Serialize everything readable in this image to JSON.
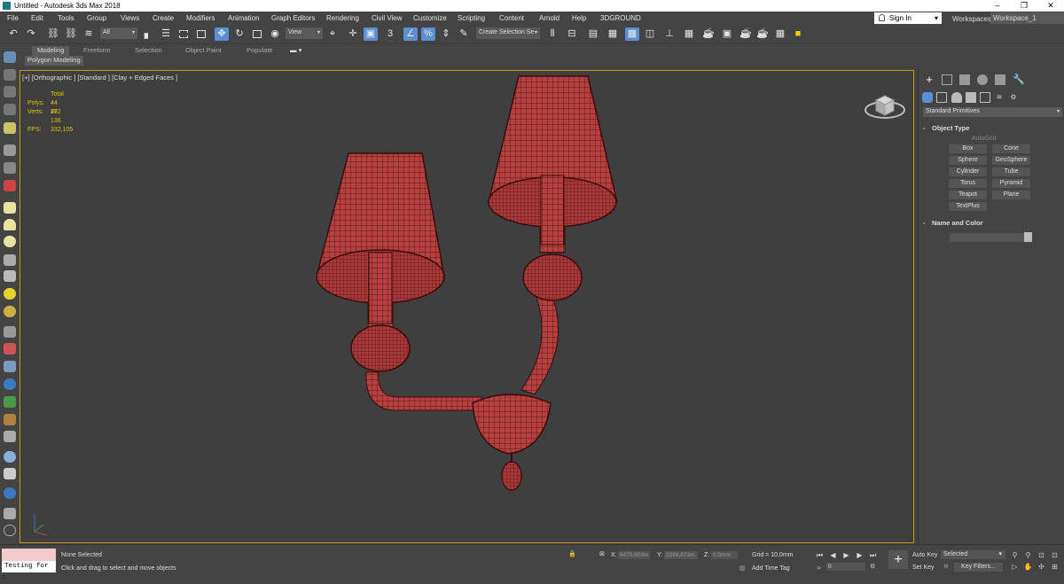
{
  "window": {
    "title": "Untitled - Autodesk 3ds Max 2018",
    "minimize": "–",
    "restore": "❐",
    "close": "✕"
  },
  "menu": [
    "File",
    "Edit",
    "Tools",
    "Group",
    "Views",
    "Create",
    "Modifiers",
    "Animation",
    "Graph Editors",
    "Rendering",
    "Civil View",
    "Customize",
    "Scripting",
    "Content",
    "Arnold",
    "Help",
    "3DGROUND"
  ],
  "signin": {
    "label": "Sign In",
    "caret": "▾"
  },
  "workspaces": {
    "label": "Workspaces:",
    "value": "Workspace_1"
  },
  "toolbar": {
    "filter": "All",
    "ref_coord": "View",
    "snap_label": "3",
    "selection_set": "Create Selection Se",
    "caret": "▾"
  },
  "ribbon": {
    "tabs": [
      "Modeling",
      "Freeform",
      "Selection",
      "Object Paint",
      "Populate"
    ],
    "active_tab": "Modeling",
    "sub": "Polygon Modeling"
  },
  "viewport": {
    "label": "[+] [Orthographic ] [Standard ] [Clay + Edged Faces ]",
    "stats_header": "Total",
    "polys_label": "Polys:",
    "polys": "44 462",
    "verts_label": "Verts:",
    "verts": "27 136",
    "fps_label": "FPS:",
    "fps": "332,105"
  },
  "command_panel": {
    "dropdown": "Standard Primitives",
    "object_type": "Object Type",
    "autogrid": "AutoGrid",
    "primitives": [
      "Box",
      "Cone",
      "Sphere",
      "GeoSphere",
      "Cylinder",
      "Tube",
      "Torus",
      "Pyramid",
      "Teapot",
      "Plane",
      "TextPlus"
    ],
    "name_and_color": "Name and Color",
    "rollout_sign": "-"
  },
  "statusbar": {
    "selection": "None Selected",
    "prompt": "Click and drag to select and move objects",
    "maxscript": "Testing for :",
    "x_label": "X:",
    "x_value": "6475,609m",
    "y_label": "Y:",
    "y_value": "2289,873m",
    "z_label": "Z:",
    "z_value": "0,0mm",
    "grid": "Grid = 10,0mm",
    "add_time_tag": "Add Time Tag",
    "frame": "0",
    "auto_key": "Auto Key",
    "selected": "Selected",
    "set_key": "Set Key",
    "key_filters": "Key Filters..."
  },
  "colors": {
    "accent": "#5b8fd2",
    "viewport_border": "#c59a0a",
    "stats_text": "#e0c200",
    "model_fill": "#b5403f",
    "model_wire": "#3a0d0d"
  },
  "icons": [
    "undo-icon",
    "redo-icon",
    "link-icon",
    "unlink-icon",
    "bind-space-warp-icon",
    "select-object-icon",
    "select-by-name-icon",
    "rect-select-region-icon",
    "window-crossing-icon",
    "select-move-icon",
    "select-rotate-icon",
    "select-scale-icon",
    "snap-toggle-icon",
    "angle-snap-icon",
    "percent-snap-icon",
    "spinner-snap-icon",
    "mirror-icon",
    "align-icon",
    "layer-explorer-icon",
    "ribbon-toggle-icon",
    "material-editor-icon",
    "render-setup-icon",
    "render-icon"
  ]
}
